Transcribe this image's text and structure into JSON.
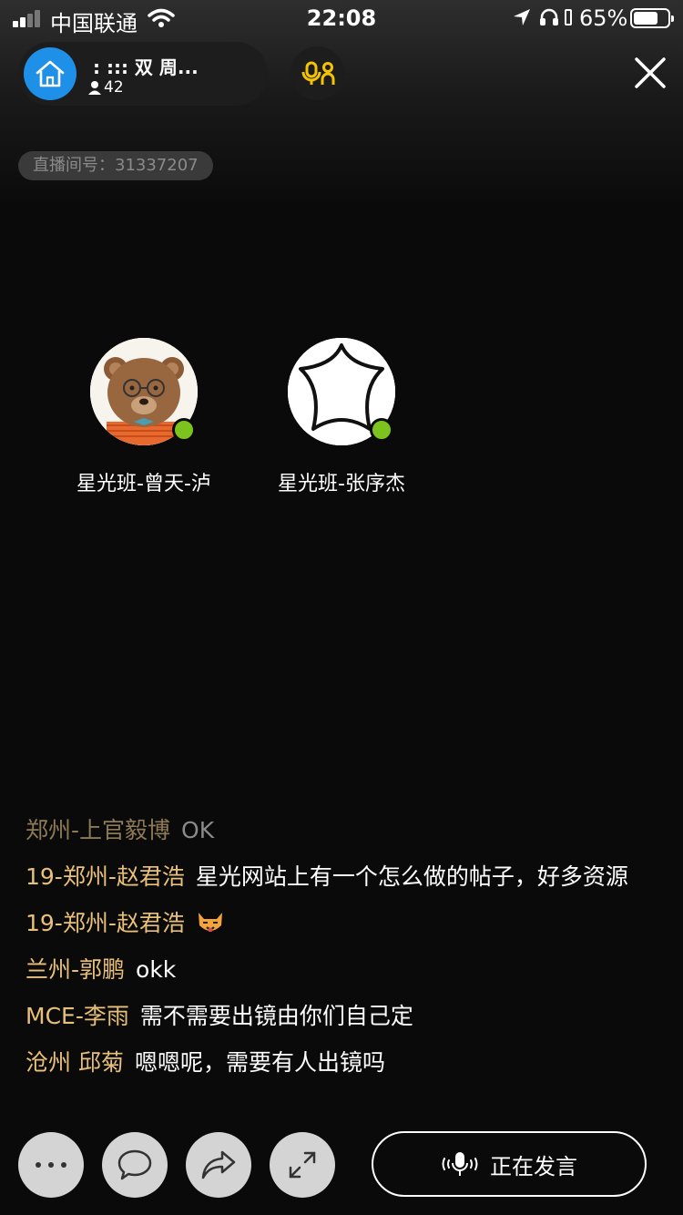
{
  "status_bar": {
    "carrier": "中国联通",
    "time": "22:08",
    "battery_percent": "65%"
  },
  "header": {
    "room_title": ":  :::      双 周...",
    "member_count": "42",
    "room_id": "直播间号：31337207"
  },
  "speakers": [
    {
      "name": "星光班-曾天-泸",
      "online": true,
      "avatar": "bear-with-glasses"
    },
    {
      "name": "星光班-张序杰",
      "online": true,
      "avatar": "white-star"
    }
  ],
  "chat": [
    {
      "user": "郑州-上官毅博",
      "text": "OK",
      "faded": true
    },
    {
      "user": "19-郑州-赵君浩",
      "text": "星光网站上有一个怎么做的帖子，好多资源",
      "faded": false
    },
    {
      "user": "19-郑州-赵君浩",
      "text": "",
      "emoji": "cat-face-emoji",
      "faded": false
    },
    {
      "user": "兰州-郭鹏",
      "text": "okk",
      "faded": false
    },
    {
      "user": "MCE-李雨",
      "text": "需不需要出镜由你们自己定",
      "faded": false
    },
    {
      "user": "沧州 邱菊",
      "text": "嗯嗯呢，需要有人出镜吗",
      "faded": false
    }
  ],
  "bottom_bar": {
    "speak_label": "正在发言"
  },
  "colors": {
    "accent_home": "#1e90e8",
    "mic_yellow": "#f5c400",
    "online": "#7cc31d",
    "chat_user": "#e9c07a"
  }
}
